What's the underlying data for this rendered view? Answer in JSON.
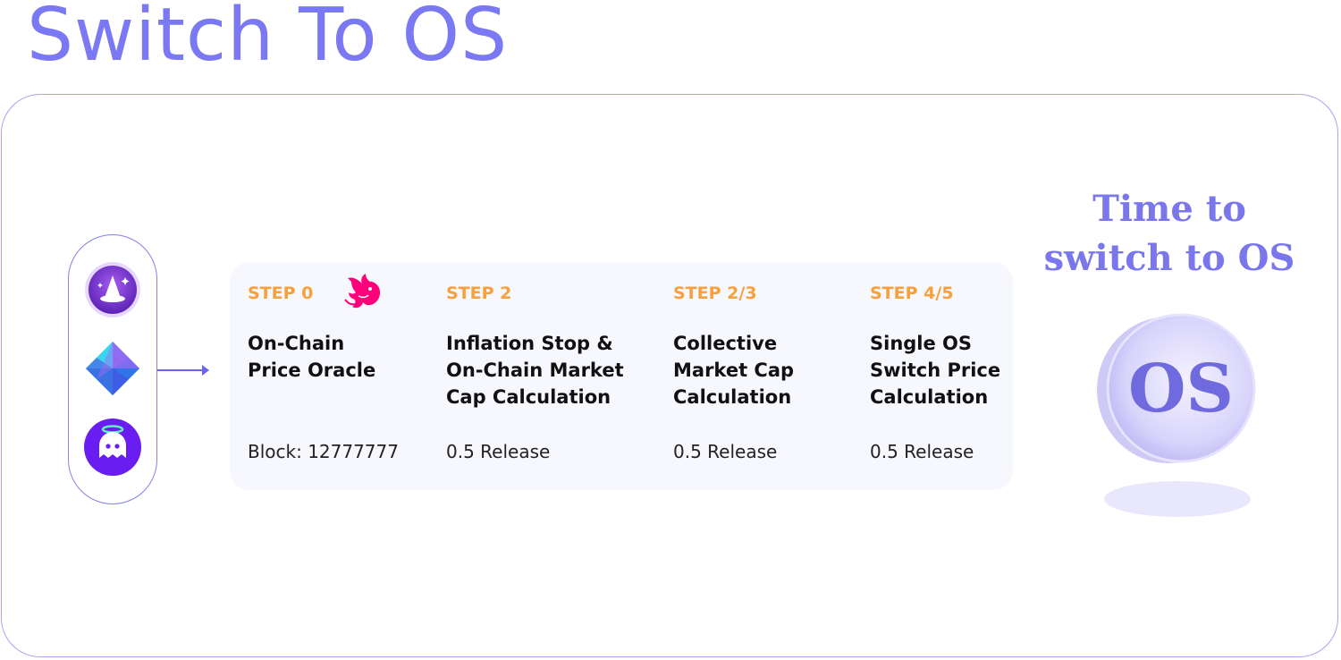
{
  "page": {
    "title": "Switch To OS"
  },
  "tokens": [
    {
      "icon": "wizard-hat-token-icon"
    },
    {
      "icon": "crystal-prism-token-icon"
    },
    {
      "icon": "ghost-halo-token-icon"
    }
  ],
  "steps": [
    {
      "label": "STEP 0",
      "name": "On-Chain\nPrice Oracle",
      "footer": "Block: 12777777",
      "icon": "uniswap-unicorn-icon"
    },
    {
      "label": "STEP 2",
      "name": "Inflation Stop &\nOn-Chain Market\nCap Calculation",
      "footer": "0.5 Release"
    },
    {
      "label": "STEP 2/3",
      "name": "Collective\nMarket Cap\nCalculation",
      "footer": "0.5 Release"
    },
    {
      "label": "STEP 4/5",
      "name": "Single OS\nSwitch Price\nCalculation",
      "footer": "0.5 Release"
    }
  ],
  "cta": {
    "text": "Time to\nswitch to OS"
  },
  "coin": {
    "label": "OS",
    "icon": "os-coin-icon"
  },
  "colors": {
    "accent": "#7a78f2",
    "step_label": "#f7a03d",
    "card_bg": "#f7f7fe",
    "frame_border": "#a7a4f0",
    "unicorn": "#ff007a"
  }
}
